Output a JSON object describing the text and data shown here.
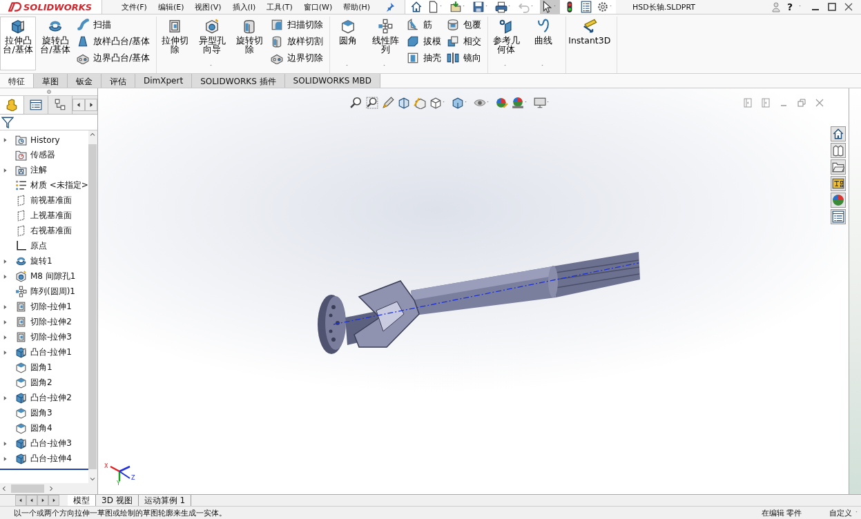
{
  "app": {
    "logo": "SOLIDWORKS"
  },
  "menu": [
    {
      "label": "文件(F)"
    },
    {
      "label": "编辑(E)"
    },
    {
      "label": "视图(V)"
    },
    {
      "label": "插入(I)"
    },
    {
      "label": "工具(T)"
    },
    {
      "label": "窗口(W)"
    },
    {
      "label": "帮助(H)"
    }
  ],
  "document_title": "HSD长轴.SLDPRT",
  "help_button": "?",
  "ribbon": {
    "groups": [
      {
        "items": [
          {
            "kind": "boss",
            "label": "拉伸凸台/基体",
            "selected": true
          },
          {
            "kind": "revolve",
            "label": "旋转凸台/基体",
            "selected": false
          },
          {
            "kind": "stack",
            "items": [
              {
                "kind": "sweep",
                "label": "扫描"
              },
              {
                "kind": "loft",
                "label": "放样凸台/基体"
              },
              {
                "kind": "boundary",
                "label": "边界凸台/基体"
              }
            ]
          }
        ]
      },
      {
        "items": [
          {
            "kind": "cut",
            "label": "拉伸切除",
            "selected": false
          },
          {
            "kind": "hole",
            "label": "异型孔向导",
            "selected": false,
            "dropdown": true
          },
          {
            "kind": "revcut",
            "label": "旋转切除",
            "selected": false
          },
          {
            "kind": "stack",
            "items": [
              {
                "kind": "sweepcut",
                "label": "扫描切除"
              },
              {
                "kind": "revcut",
                "label": "放样切割"
              },
              {
                "kind": "boundary",
                "label": "边界切除"
              }
            ]
          }
        ]
      },
      {
        "items": [
          {
            "kind": "fillet",
            "label": "圆角",
            "selected": false,
            "dropdown": true
          },
          {
            "kind": "pattern",
            "label": "线性阵列",
            "selected": false,
            "dropdown": true
          },
          {
            "kind": "stack",
            "items": [
              {
                "kind": "rib",
                "label": "筋"
              },
              {
                "kind": "draft",
                "label": "拔模"
              },
              {
                "kind": "shell",
                "label": "抽壳"
              }
            ]
          },
          {
            "kind": "stack",
            "items": [
              {
                "kind": "wrap",
                "label": "包覆"
              },
              {
                "kind": "intersect",
                "label": "相交"
              },
              {
                "kind": "mirror",
                "label": "镜向"
              }
            ]
          }
        ]
      },
      {
        "items": [
          {
            "kind": "refgeom",
            "label": "参考几何体",
            "selected": false,
            "dropdown": true
          },
          {
            "kind": "curve",
            "label": "曲线",
            "selected": false,
            "dropdown": true
          }
        ]
      },
      {
        "items": [
          {
            "kind": "instant3d",
            "label": "Instant3D",
            "selected": false
          }
        ]
      }
    ]
  },
  "command_tabs": [
    {
      "label": "特征",
      "selected": true
    },
    {
      "label": "草图",
      "selected": false
    },
    {
      "label": "钣金",
      "selected": false
    },
    {
      "label": "评估",
      "selected": false
    },
    {
      "label": "DimXpert",
      "selected": false
    },
    {
      "label": "SOLIDWORKS 插件",
      "selected": false
    },
    {
      "label": "SOLIDWORKS MBD",
      "selected": false
    }
  ],
  "panel_tabs": [
    {
      "kind": "feature",
      "selected": true
    },
    {
      "kind": "property",
      "selected": false
    },
    {
      "kind": "config",
      "selected": false
    }
  ],
  "tree": [
    {
      "kind": "history",
      "label": "History",
      "expandable": true
    },
    {
      "kind": "sensors",
      "label": "传感器",
      "expandable": false
    },
    {
      "kind": "annotations",
      "label": "注解",
      "expandable": true
    },
    {
      "kind": "material",
      "label": "材质 <未指定>",
      "expandable": false
    },
    {
      "kind": "plane",
      "label": "前视基准面",
      "expandable": false
    },
    {
      "kind": "plane",
      "label": "上视基准面",
      "expandable": false
    },
    {
      "kind": "plane",
      "label": "右视基准面",
      "expandable": false
    },
    {
      "kind": "origin",
      "label": "原点",
      "expandable": false
    },
    {
      "kind": "revolve",
      "label": "旋转1",
      "expandable": true
    },
    {
      "kind": "hole",
      "label": "M8 间隙孔1",
      "expandable": true
    },
    {
      "kind": "pattern",
      "label": "阵列(圆周)1",
      "expandable": false
    },
    {
      "kind": "cut",
      "label": "切除-拉伸1",
      "expandable": true
    },
    {
      "kind": "cut",
      "label": "切除-拉伸2",
      "expandable": true
    },
    {
      "kind": "cut",
      "label": "切除-拉伸3",
      "expandable": true
    },
    {
      "kind": "boss",
      "label": "凸台-拉伸1",
      "expandable": true
    },
    {
      "kind": "fillet",
      "label": "圆角1",
      "expandable": false
    },
    {
      "kind": "fillet",
      "label": "圆角2",
      "expandable": false
    },
    {
      "kind": "boss",
      "label": "凸台-拉伸2",
      "expandable": true
    },
    {
      "kind": "fillet",
      "label": "圆角3",
      "expandable": false
    },
    {
      "kind": "fillet",
      "label": "圆角4",
      "expandable": false
    },
    {
      "kind": "boss",
      "label": "凸台-拉伸3",
      "expandable": true
    },
    {
      "kind": "boss",
      "label": "凸台-拉伸4",
      "expandable": true
    }
  ],
  "triad": {
    "x": "X",
    "y": "Y",
    "z": "Z"
  },
  "view_tabs": [
    {
      "label": "模型",
      "selected": true
    },
    {
      "label": "3D 视图",
      "selected": false
    },
    {
      "label": "运动算例 1",
      "selected": false
    }
  ],
  "status_bar": {
    "message": "以一个或两个方向拉伸一草图或绘制的草图轮廓来生成一实体。",
    "mode": "在编辑 零件",
    "units": "自定义"
  }
}
